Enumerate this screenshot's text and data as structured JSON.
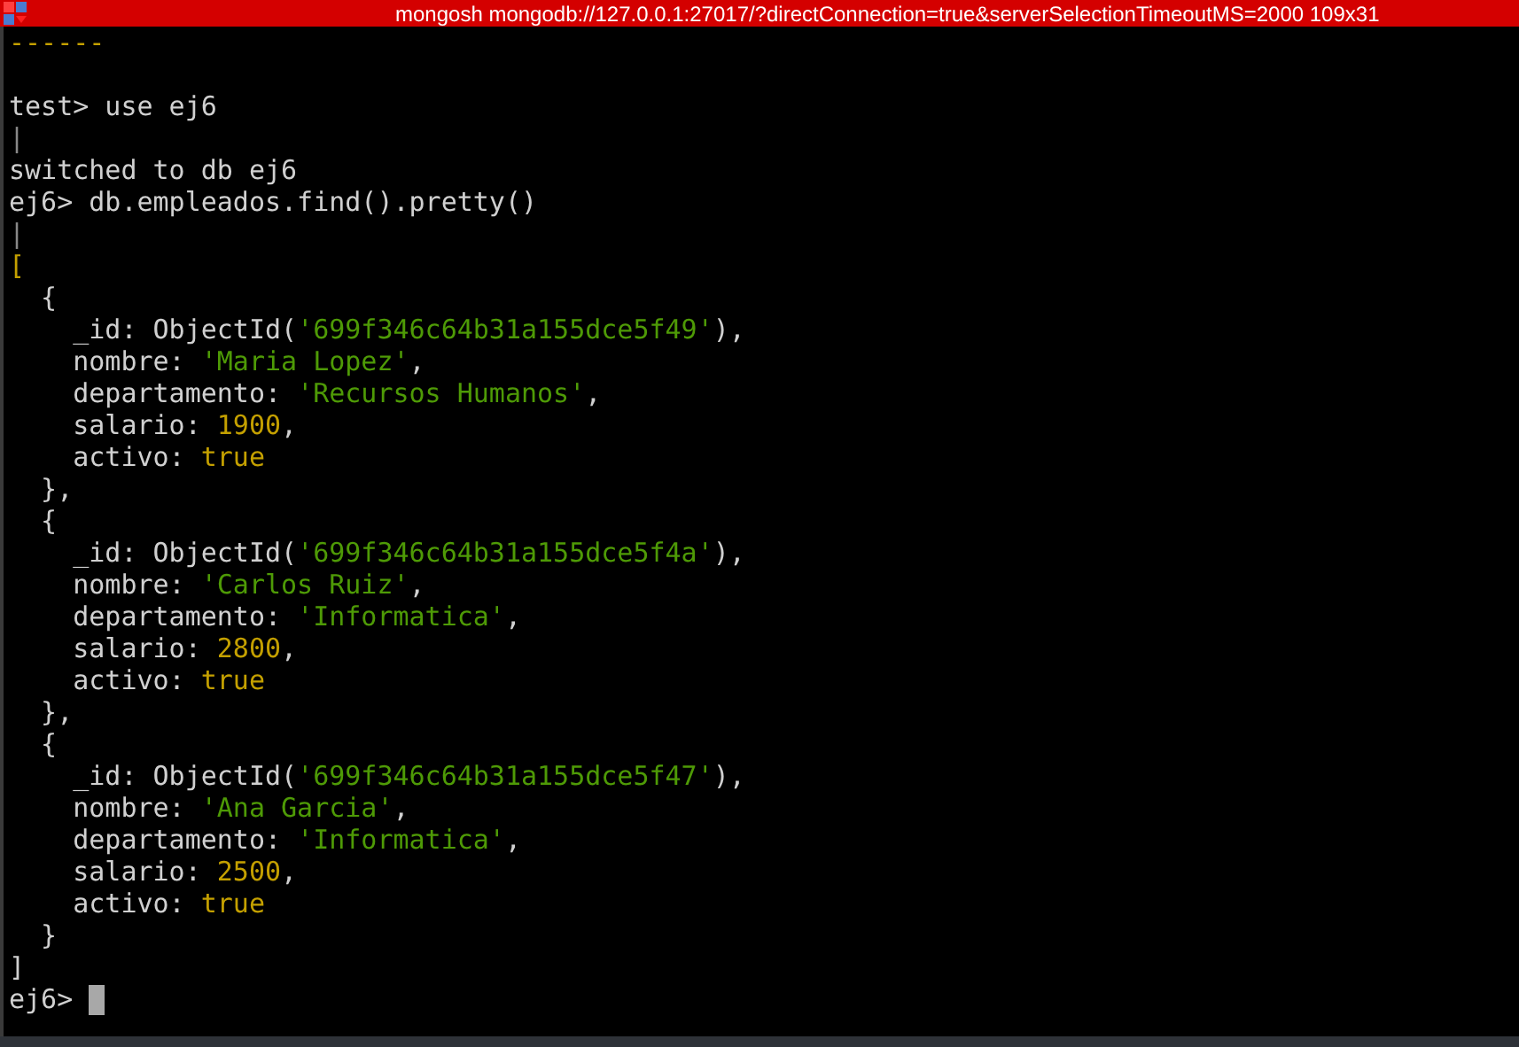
{
  "window": {
    "title": "mongosh mongodb://127.0.0.1:27017/?directConnection=true&serverSelectionTimeoutMS=2000 109x31"
  },
  "lines": [
    {
      "kind": "text",
      "segments": [
        {
          "text": "------",
          "kind": "number"
        }
      ]
    },
    {
      "kind": "blank"
    },
    {
      "kind": "text",
      "segments": [
        {
          "text": "test> use ej6",
          "kind": "plain"
        }
      ]
    },
    {
      "kind": "text",
      "segments": [
        {
          "text": "|",
          "kind": "dim"
        }
      ]
    },
    {
      "kind": "text",
      "segments": [
        {
          "text": "switched to db ej6",
          "kind": "plain"
        }
      ]
    },
    {
      "kind": "text",
      "segments": [
        {
          "text": "ej6> db.empleados.find().pretty()",
          "kind": "plain"
        }
      ]
    },
    {
      "kind": "text",
      "segments": [
        {
          "text": "|",
          "kind": "dim"
        }
      ]
    },
    {
      "kind": "text",
      "segments": [
        {
          "text": "[",
          "kind": "number"
        }
      ]
    },
    {
      "kind": "text",
      "segments": [
        {
          "text": "  {",
          "kind": "plain"
        }
      ]
    },
    {
      "kind": "text",
      "segments": [
        {
          "text": "    _id: ObjectId(",
          "kind": "plain"
        },
        {
          "text": "'699f346c64b31a155dce5f49'",
          "kind": "string"
        },
        {
          "text": "),",
          "kind": "plain"
        }
      ]
    },
    {
      "kind": "text",
      "segments": [
        {
          "text": "    nombre: ",
          "kind": "plain"
        },
        {
          "text": "'Maria Lopez'",
          "kind": "string"
        },
        {
          "text": ",",
          "kind": "plain"
        }
      ]
    },
    {
      "kind": "text",
      "segments": [
        {
          "text": "    departamento: ",
          "kind": "plain"
        },
        {
          "text": "'Recursos Humanos'",
          "kind": "string"
        },
        {
          "text": ",",
          "kind": "plain"
        }
      ]
    },
    {
      "kind": "text",
      "segments": [
        {
          "text": "    salario: ",
          "kind": "plain"
        },
        {
          "text": "1900",
          "kind": "number"
        },
        {
          "text": ",",
          "kind": "plain"
        }
      ]
    },
    {
      "kind": "text",
      "segments": [
        {
          "text": "    activo: ",
          "kind": "plain"
        },
        {
          "text": "true",
          "kind": "number"
        }
      ]
    },
    {
      "kind": "text",
      "segments": [
        {
          "text": "  },",
          "kind": "plain"
        }
      ]
    },
    {
      "kind": "text",
      "segments": [
        {
          "text": "  {",
          "kind": "plain"
        }
      ]
    },
    {
      "kind": "text",
      "segments": [
        {
          "text": "    _id: ObjectId(",
          "kind": "plain"
        },
        {
          "text": "'699f346c64b31a155dce5f4a'",
          "kind": "string"
        },
        {
          "text": "),",
          "kind": "plain"
        }
      ]
    },
    {
      "kind": "text",
      "segments": [
        {
          "text": "    nombre: ",
          "kind": "plain"
        },
        {
          "text": "'Carlos Ruiz'",
          "kind": "string"
        },
        {
          "text": ",",
          "kind": "plain"
        }
      ]
    },
    {
      "kind": "text",
      "segments": [
        {
          "text": "    departamento: ",
          "kind": "plain"
        },
        {
          "text": "'Informatica'",
          "kind": "string"
        },
        {
          "text": ",",
          "kind": "plain"
        }
      ]
    },
    {
      "kind": "text",
      "segments": [
        {
          "text": "    salario: ",
          "kind": "plain"
        },
        {
          "text": "2800",
          "kind": "number"
        },
        {
          "text": ",",
          "kind": "plain"
        }
      ]
    },
    {
      "kind": "text",
      "segments": [
        {
          "text": "    activo: ",
          "kind": "plain"
        },
        {
          "text": "true",
          "kind": "number"
        }
      ]
    },
    {
      "kind": "text",
      "segments": [
        {
          "text": "  },",
          "kind": "plain"
        }
      ]
    },
    {
      "kind": "text",
      "segments": [
        {
          "text": "  {",
          "kind": "plain"
        }
      ]
    },
    {
      "kind": "text",
      "segments": [
        {
          "text": "    _id: ObjectId(",
          "kind": "plain"
        },
        {
          "text": "'699f346c64b31a155dce5f47'",
          "kind": "string"
        },
        {
          "text": "),",
          "kind": "plain"
        }
      ]
    },
    {
      "kind": "text",
      "segments": [
        {
          "text": "    nombre: ",
          "kind": "plain"
        },
        {
          "text": "'Ana Garcia'",
          "kind": "string"
        },
        {
          "text": ",",
          "kind": "plain"
        }
      ]
    },
    {
      "kind": "text",
      "segments": [
        {
          "text": "    departamento: ",
          "kind": "plain"
        },
        {
          "text": "'Informatica'",
          "kind": "string"
        },
        {
          "text": ",",
          "kind": "plain"
        }
      ]
    },
    {
      "kind": "text",
      "segments": [
        {
          "text": "    salario: ",
          "kind": "plain"
        },
        {
          "text": "2500",
          "kind": "number"
        },
        {
          "text": ",",
          "kind": "plain"
        }
      ]
    },
    {
      "kind": "text",
      "segments": [
        {
          "text": "    activo: ",
          "kind": "plain"
        },
        {
          "text": "true",
          "kind": "number"
        }
      ]
    },
    {
      "kind": "text",
      "segments": [
        {
          "text": "  }",
          "kind": "plain"
        }
      ]
    },
    {
      "kind": "text",
      "segments": [
        {
          "text": "]",
          "kind": "plain"
        }
      ]
    },
    {
      "kind": "text",
      "cursor": true,
      "segments": [
        {
          "text": "ej6> ",
          "kind": "plain"
        }
      ]
    }
  ]
}
